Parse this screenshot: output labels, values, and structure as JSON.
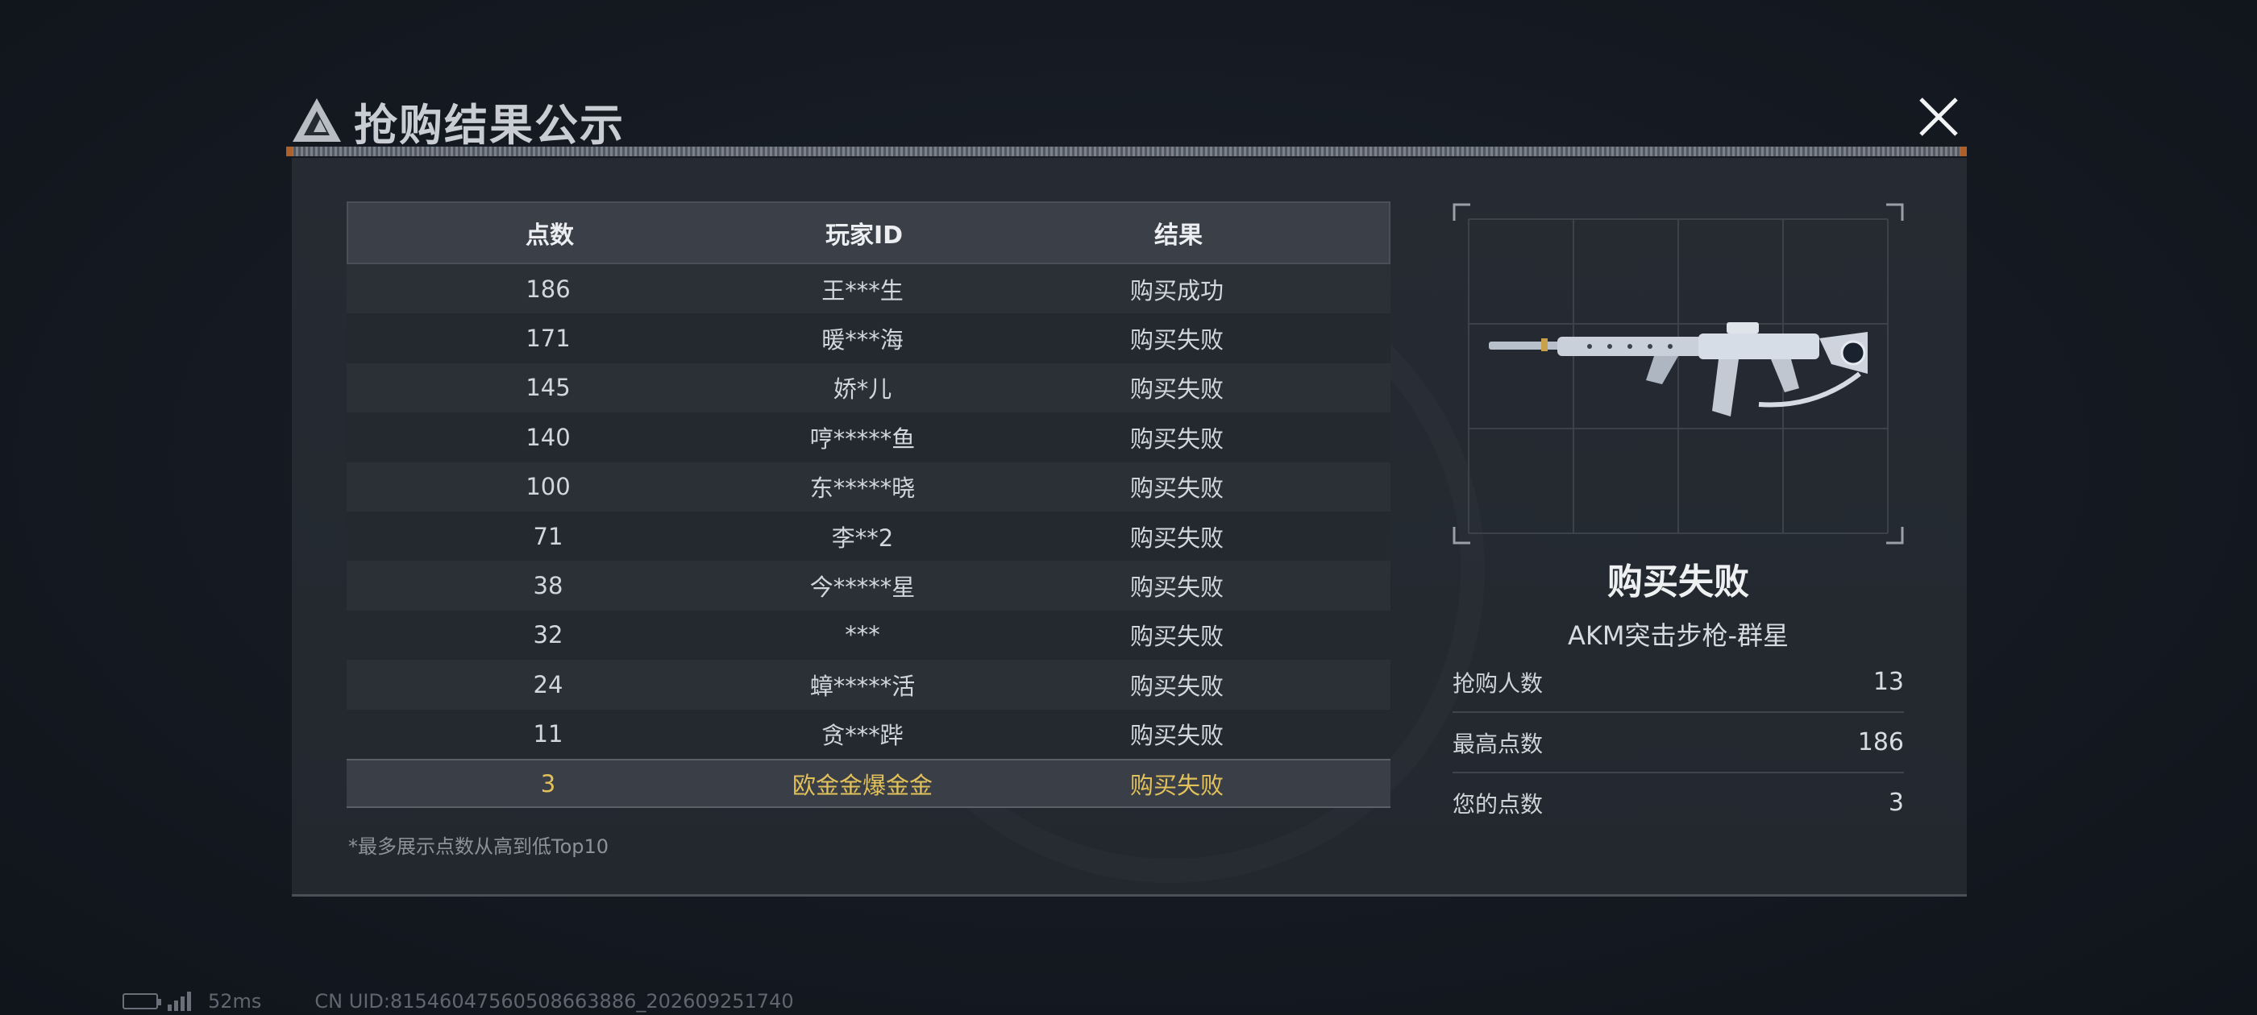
{
  "title": "抢购结果公示",
  "table": {
    "headers": {
      "points": "点数",
      "player_id": "玩家ID",
      "result": "结果"
    },
    "rows": [
      {
        "points": "186",
        "player": "王***生",
        "result": "购买成功"
      },
      {
        "points": "171",
        "player": "暖***海",
        "result": "购买失败"
      },
      {
        "points": "145",
        "player": "娇*儿",
        "result": "购买失败"
      },
      {
        "points": "140",
        "player": "哼*****鱼",
        "result": "购买失败"
      },
      {
        "points": "100",
        "player": "东*****晓",
        "result": "购买失败"
      },
      {
        "points": "71",
        "player": "李**2",
        "result": "购买失败"
      },
      {
        "points": "38",
        "player": "今*****星",
        "result": "购买失败"
      },
      {
        "points": "32",
        "player": "***",
        "result": "购买失败"
      },
      {
        "points": "24",
        "player": "蟑*****活",
        "result": "购买失败"
      },
      {
        "points": "11",
        "player": "贪***跸",
        "result": "购买失败"
      }
    ],
    "my_row": {
      "points": "3",
      "player": "欧金金爆金金",
      "result": "购买失败"
    },
    "footnote": "*最多展示点数从高到低Top10"
  },
  "item": {
    "status": "购买失败",
    "name": "AKM突击步枪-群星",
    "stats": [
      {
        "label": "抢购人数",
        "value": "13"
      },
      {
        "label": "最高点数",
        "value": "186"
      },
      {
        "label": "您的点数",
        "value": "3"
      }
    ]
  },
  "statusbar": {
    "ping": "52ms",
    "uid": "CN UID:8154604756050866​3886_202609251740"
  },
  "colors": {
    "highlight_text": "#e2c15a",
    "panel_bg": "#262b33",
    "header_bg": "#3b4048",
    "accent_orange": "#c86d2e"
  },
  "icons": {
    "logo": "triangle-logo-icon",
    "close": "close-icon",
    "battery": "battery-icon",
    "signal": "signal-icon"
  }
}
